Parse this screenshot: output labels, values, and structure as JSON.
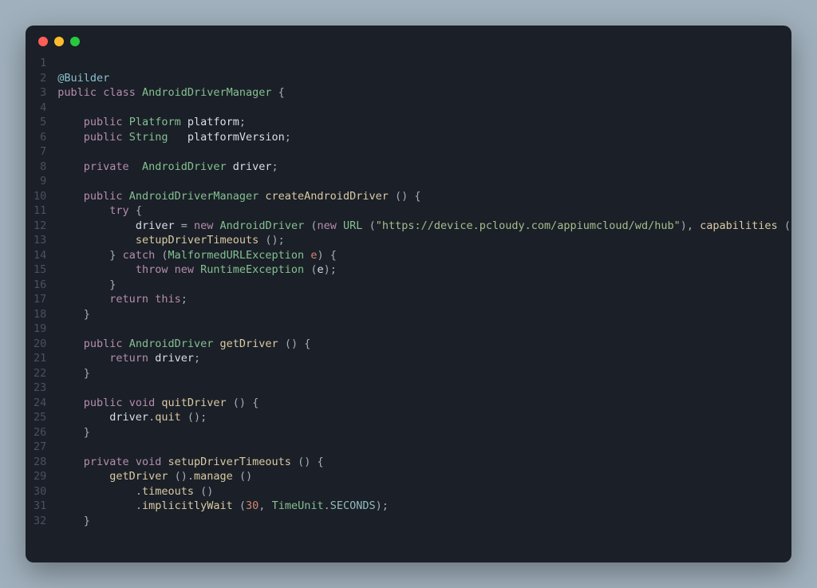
{
  "window": {
    "dot_red": "#ff5f56",
    "dot_yellow": "#ffbd2e",
    "dot_green": "#27c93f"
  },
  "code": {
    "language": "java",
    "line_count": 32,
    "url_string": "\"https://device.pcloudy.com/appiumcloud/wd/hub\"",
    "implicit_wait_value": "30",
    "time_unit": "SECONDS",
    "tokens": {
      "builder": "Builder",
      "public": "public",
      "private": "private",
      "class": "class",
      "void": "void",
      "new": "new",
      "try": "try",
      "catch": "catch",
      "throw": "throw",
      "return": "return",
      "this": "this",
      "AndroidDriverManager": "AndroidDriverManager",
      "Platform": "Platform",
      "String": "String",
      "AndroidDriver": "AndroidDriver",
      "URL": "URL",
      "MalformedURLException": "MalformedURLException",
      "RuntimeException": "RuntimeException",
      "TimeUnit": "TimeUnit",
      "platform": "platform",
      "platformVersion": "platformVersion",
      "driver": "driver",
      "createAndroidDriver": "createAndroidDriver",
      "setupDriverTimeouts": "setupDriverTimeouts",
      "capabilities": "capabilities",
      "e": "e",
      "getDriver": "getDriver",
      "quitDriver": "quitDriver",
      "quit": "quit",
      "manage": "manage",
      "timeouts": "timeouts",
      "implicitlyWait": "implicitlyWait"
    },
    "braces": {
      "open": "{",
      "close": "}",
      "popen": "(",
      "pclose": ")",
      "semi": ";",
      "comma": ",",
      "at": "@",
      "eq": "=",
      "dot": "."
    }
  }
}
